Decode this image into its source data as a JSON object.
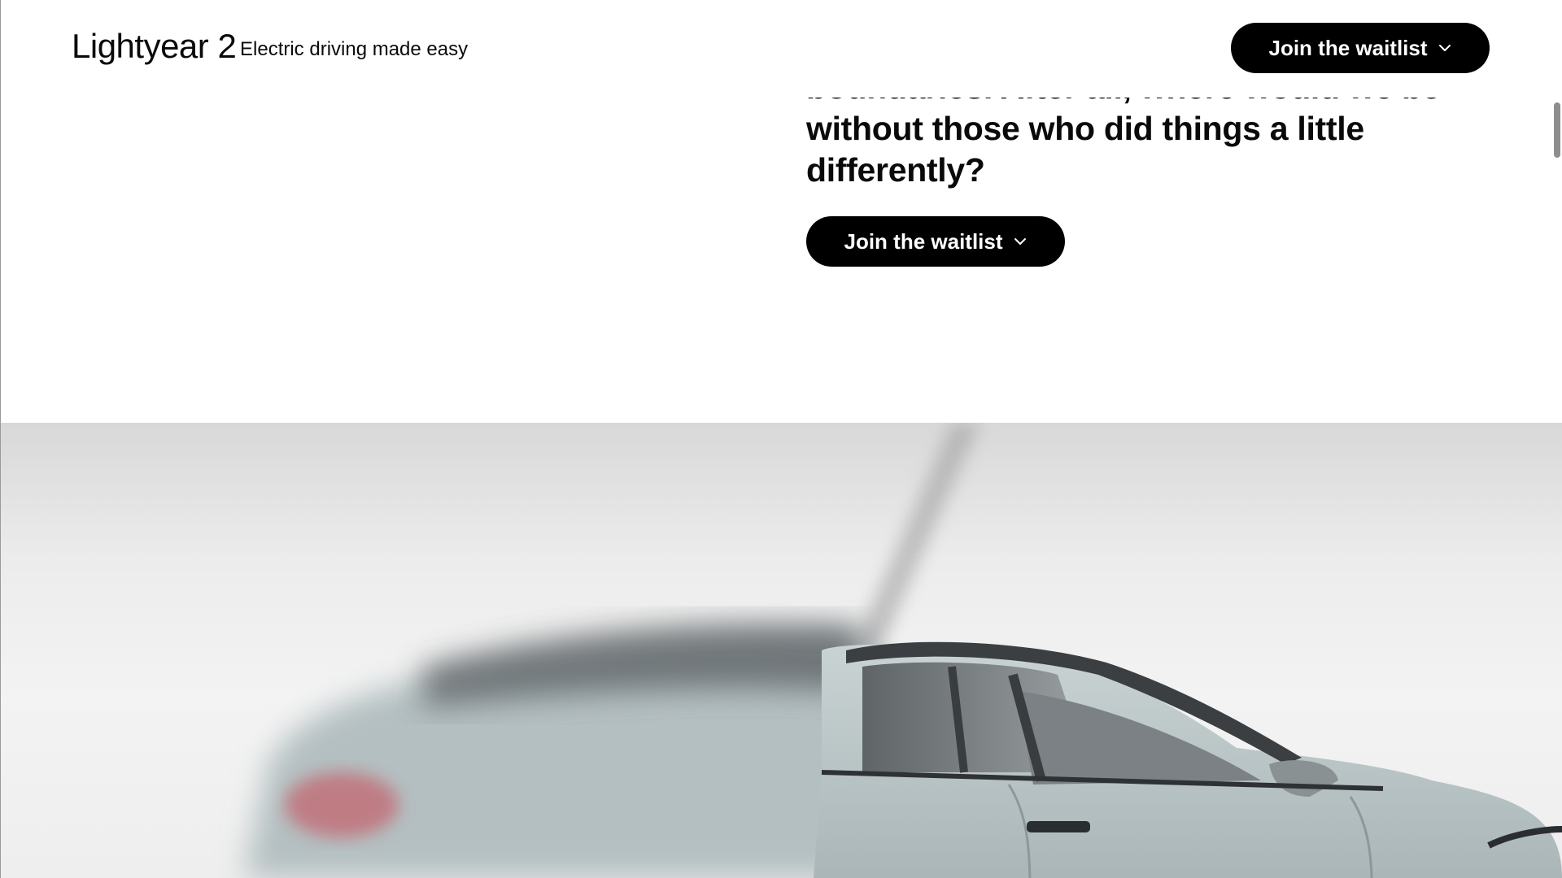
{
  "header": {
    "logo": "Lightyear 2",
    "tagline": "Electric driving made easy",
    "cta_label": "Join the waitlist"
  },
  "main": {
    "statement_lines": [
      "boundaries. After all, where would we be",
      "without those who did things a little",
      "differently?"
    ],
    "cta_label": "Join the waitlist"
  },
  "hero": {
    "image": "car-side-profile-image"
  },
  "icons": {
    "cta_icon": "chevron-down-icon"
  },
  "colors": {
    "button_bg": "#000000",
    "button_text": "#ffffff",
    "car_body": "#b8c5c7"
  }
}
